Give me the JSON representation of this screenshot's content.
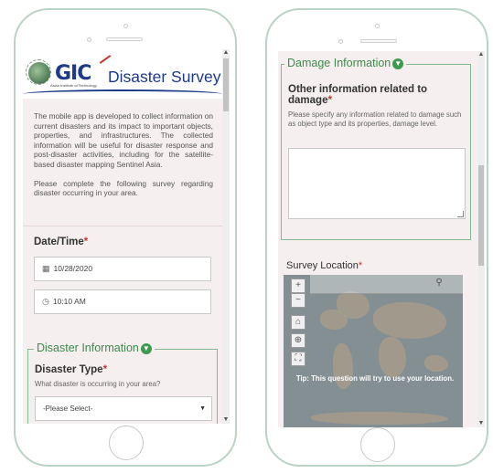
{
  "left": {
    "header": {
      "logo_text": "GIC",
      "logo_sub": "Asian Institute of Technology",
      "app_title": "Disaster Survey"
    },
    "intro": {
      "p1": "The mobile app is developed to collect information on current disasters and its impact to important objects, properties, and infrastructures. The collected information will be useful for disaster response and post-disaster activities, including for the satellite-based disaster mapping Sentinel Asia.",
      "p2": "Please complete the following survey regarding disaster occurring in your area."
    },
    "datetime": {
      "label": "Date/Time",
      "required_mark": "*",
      "date_value": "10/28/2020",
      "time_value": "10:10 AM",
      "date_icon": "calendar-icon",
      "time_icon": "clock-icon"
    },
    "disaster_group": {
      "title": "Disaster Information",
      "toggle_icon": "chevron-down-icon",
      "type_label": "Disaster Type",
      "required_mark": "*",
      "type_hint": "What disaster is occurring in your area?",
      "select_value": "-Please Select-"
    }
  },
  "right": {
    "damage_group": {
      "title": "Damage Information",
      "toggle_icon": "chevron-down-icon",
      "question_label": "Other information related to damage",
      "required_mark": "*",
      "hint": "Please specify any information related to damage such as object type and its properties, damage level.",
      "textarea_value": ""
    },
    "location": {
      "label": "Survey Location",
      "required_mark": "*",
      "tip": "Tip: This question will try to use your location.",
      "zoom_in": "+",
      "zoom_out": "−",
      "home_icon": "home-icon",
      "locate_icon": "crosshair-icon",
      "fullscreen_icon": "fullscreen-icon",
      "search_icon": "search-icon"
    }
  },
  "colors": {
    "accent_green": "#3f8a4d",
    "required_red": "#c0392b",
    "brand_blue": "#1d3a8a",
    "phone_frame": "#b9d4c4"
  }
}
